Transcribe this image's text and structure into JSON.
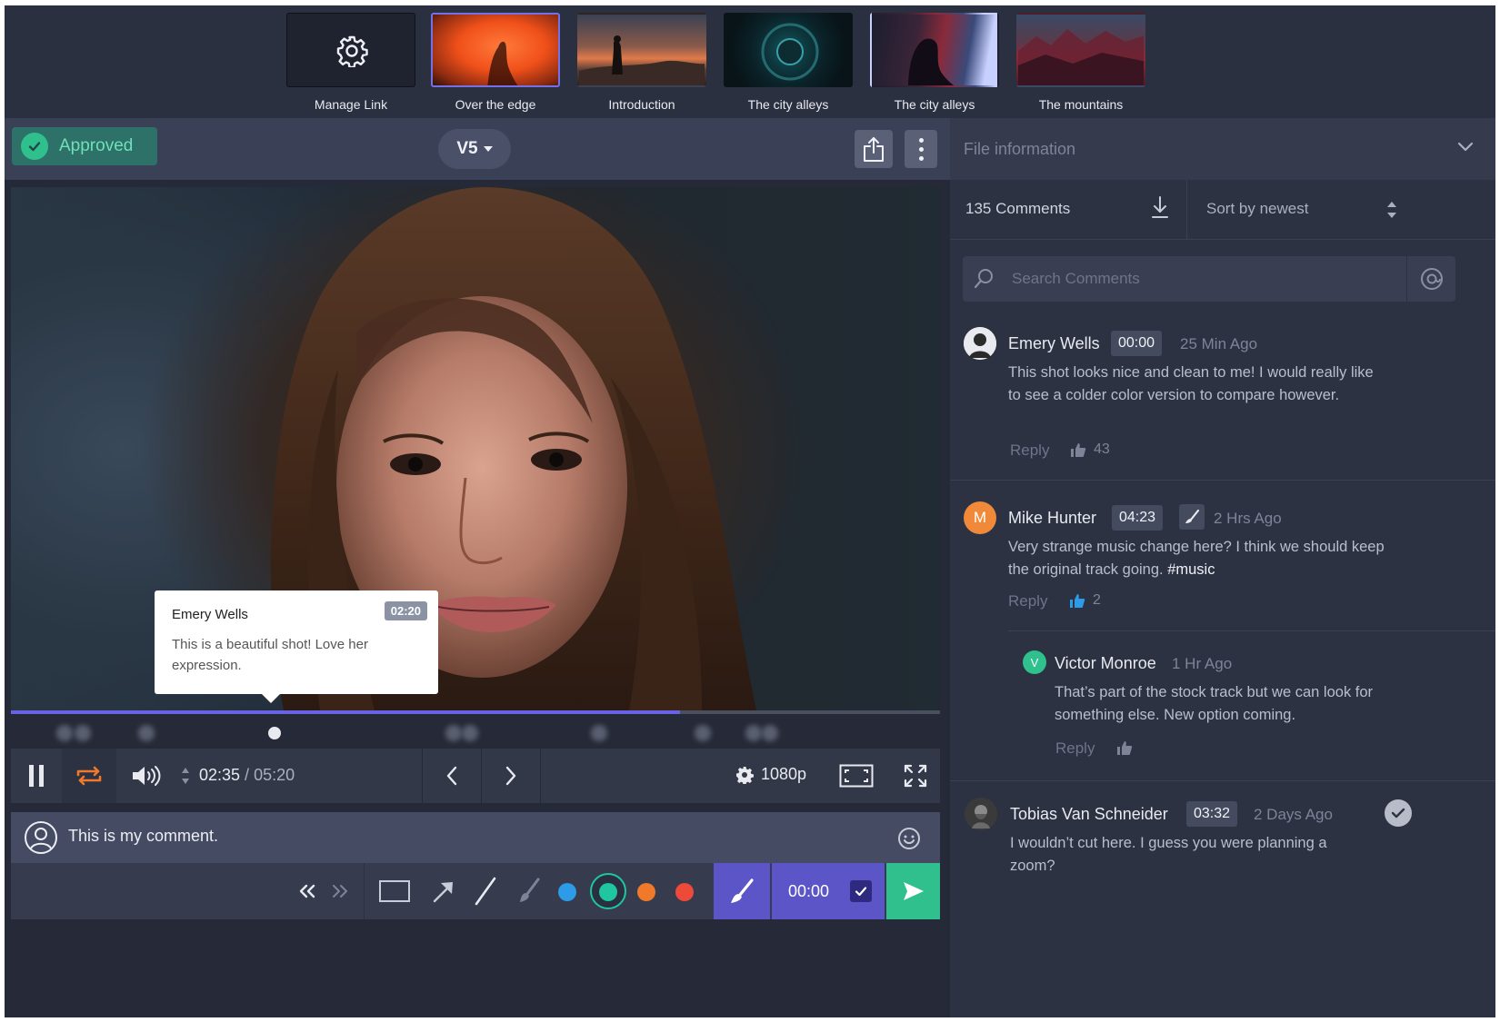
{
  "thumbnails": [
    {
      "caption": "Manage Link",
      "icon": "gear-icon"
    },
    {
      "caption": "Over the edge",
      "selected": true
    },
    {
      "caption": "Introduction"
    },
    {
      "caption": "The city alleys"
    },
    {
      "caption": "The city alleys"
    },
    {
      "caption": "The mountains"
    }
  ],
  "header": {
    "approved_label": "Approved",
    "version": "V5"
  },
  "player": {
    "progress_fraction": 0.72,
    "current_time": "02:35",
    "separator": " / ",
    "duration": "05:20",
    "quality": "1080p"
  },
  "tooltip": {
    "author": "Emery Wells",
    "time": "02:20",
    "text": "This is a beautiful shot! Love her expression."
  },
  "composer": {
    "text": "This is my comment.",
    "stamp_time": "00:00"
  },
  "colors": {
    "accent": "#5b55c8",
    "approved": "#2fc08e",
    "swatches": [
      "#2e9be6",
      "#1fc6a0",
      "#f07a2a",
      "#ee4a3a"
    ]
  },
  "panel": {
    "file_info_label": "File information",
    "comment_count": "135 Comments",
    "sort_label": "Sort by newest",
    "search_placeholder": "Search Comments"
  },
  "comments": [
    {
      "author": "Emery Wells",
      "time": "00:00",
      "ago": "25 Min Ago",
      "text": "This shot looks nice and clean to me! I would really like to see a colder color version to compare however.",
      "reply_label": "Reply",
      "likes": "43"
    },
    {
      "author": "Mike Hunter",
      "avatar_letter": "M",
      "time": "04:23",
      "ago": "2 Hrs Ago",
      "text": "Very strange music change here? I think we should keep the original track going.",
      "hashtag": "#music",
      "reply_label": "Reply",
      "likes": "2"
    },
    {
      "author": "Victor Monroe",
      "avatar_letter": "V",
      "ago": "1 Hr Ago",
      "text": "That’s part of the stock track but we can look for something else. New option coming.",
      "reply_label": "Reply"
    },
    {
      "author": "Tobias Van Schneider",
      "time": "03:32",
      "ago": "2 Days Ago",
      "text": "I wouldn’t cut here. I guess you were planning a zoom?"
    }
  ]
}
